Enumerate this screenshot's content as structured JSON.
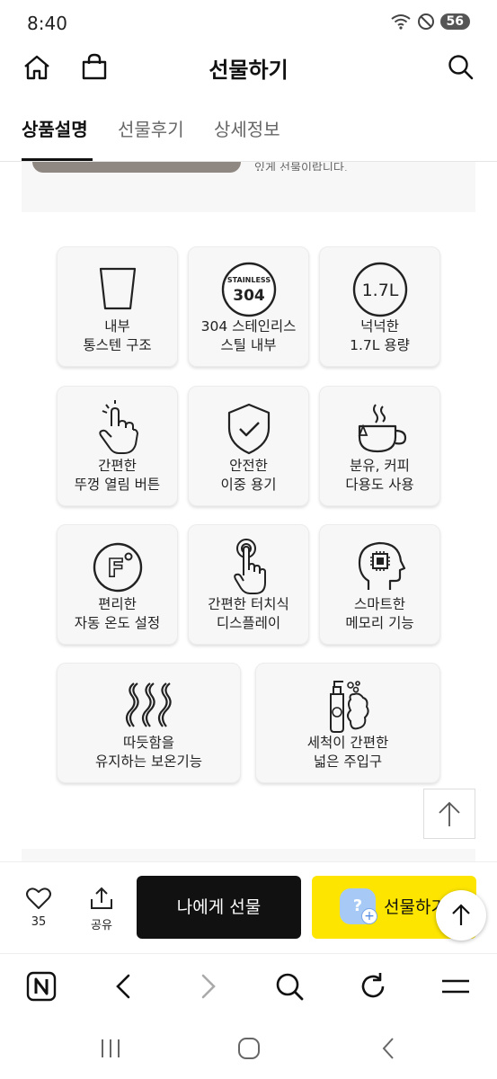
{
  "status_bar": {
    "time": "8:40",
    "battery": "56"
  },
  "header": {
    "title": "선물하기"
  },
  "tabs": [
    {
      "label": "상품설명",
      "active": true
    },
    {
      "label": "선물후기",
      "active": false
    },
    {
      "label": "상세정보",
      "active": false
    }
  ],
  "top_card": {
    "text": "있게 선물이랍니다."
  },
  "features": [
    {
      "icon": "cup-icon",
      "line1": "내부",
      "line2": "통스텐 구조"
    },
    {
      "icon": "stainless-304-badge-icon",
      "badge_top": "STAINLESS",
      "badge_num": "304",
      "line1": "304 스테인리스",
      "line2": "스틸 내부"
    },
    {
      "icon": "capacity-badge-icon",
      "badge": "1.7L",
      "line1": "넉넉한",
      "line2": "1.7L 용량"
    },
    {
      "icon": "tap-hand-icon",
      "line1": "간편한",
      "line2": "뚜껑 열림 버튼"
    },
    {
      "icon": "shield-check-icon",
      "line1": "안전한",
      "line2": "이중 용기"
    },
    {
      "icon": "tea-cup-icon",
      "line1": "분유, 커피",
      "line2": "다용도 사용"
    },
    {
      "icon": "fahrenheit-icon",
      "badge": "F",
      "line1": "편리한",
      "line2": "자동 온도 설정"
    },
    {
      "icon": "touch-finger-icon",
      "line1": "간편한 터치식",
      "line2": "디스플레이"
    },
    {
      "icon": "smart-head-icon",
      "line1": "스마트한",
      "line2": "메모리 기능"
    },
    {
      "icon": "steam-icon",
      "line1": "따듯함을",
      "line2": "유지하는 보온기능"
    },
    {
      "icon": "wash-bottle-icon",
      "line1": "세척이 간편한",
      "line2": "넓은 주입구"
    }
  ],
  "action_bar": {
    "like_count": "35",
    "share_label": "공유",
    "self_gift_label": "나에게 선물",
    "gift_label": "선물하기",
    "gift_badge": "?"
  },
  "colors": {
    "accent_yellow": "#fde500",
    "dark_button": "#111111",
    "tile_bg": "#f7f7f7"
  }
}
